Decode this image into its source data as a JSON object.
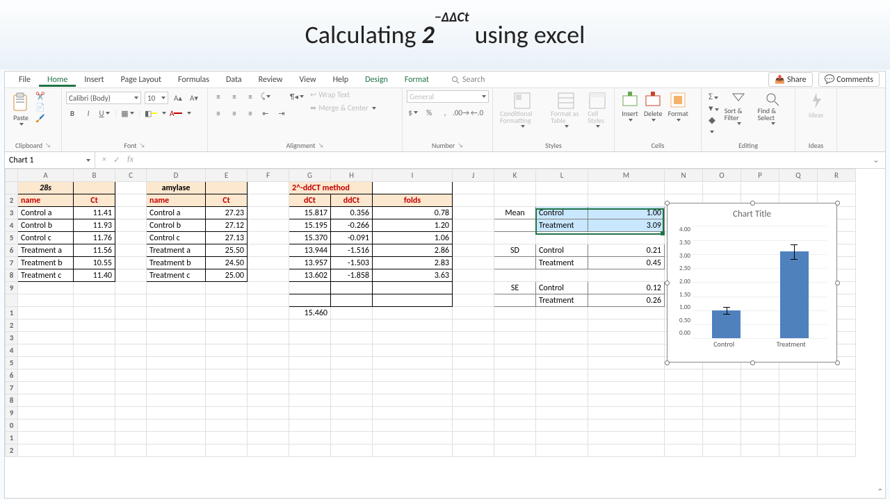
{
  "banner": {
    "pre": "Calculating ",
    "base": "2",
    "exp": "−ΔΔCt",
    "post": " using excel"
  },
  "menubar": {
    "tabs": [
      "File",
      "Home",
      "Insert",
      "Page Layout",
      "Formulas",
      "Data",
      "Review",
      "View",
      "Help",
      "Design",
      "Format"
    ],
    "active_index": 1,
    "chart_tab_start": 9,
    "search_placeholder": "Search",
    "share": "Share",
    "comments": "Comments"
  },
  "ribbon": {
    "clipboard": {
      "paste": "Paste",
      "label": "Clipboard"
    },
    "font": {
      "name": "Calibri (Body)",
      "size": "10",
      "label": "Font"
    },
    "alignment": {
      "wrap": "Wrap Text",
      "merge": "Merge & Center",
      "label": "Alignment"
    },
    "number": {
      "format": "General",
      "label": "Number"
    },
    "styles": {
      "cond": "Conditional Formatting",
      "table": "Format as Table",
      "cell": "Cell Styles",
      "label": "Styles"
    },
    "cells": {
      "insert": "Insert",
      "delete": "Delete",
      "format": "Format",
      "label": "Cells"
    },
    "editing": {
      "sort": "Sort & Filter",
      "find": "Find & Select",
      "label": "Editing"
    },
    "ideas": {
      "label": "Ideas"
    }
  },
  "fbar": {
    "namebox": "Chart 1",
    "fx": "fx"
  },
  "colwidths": {
    "rowhead": 18,
    "A": 80,
    "B": 60,
    "C": 45,
    "D": 85,
    "E": 60,
    "F": 60,
    "G": 60,
    "H": 60,
    "I": 115,
    "J": 60,
    "K": 60,
    "L": 75,
    "M": 110,
    "N": 55,
    "O": 55,
    "P": 55,
    "Q": 55,
    "R": 55
  },
  "col_letters": [
    "A",
    "B",
    "C",
    "D",
    "E",
    "F",
    "G",
    "H",
    "I",
    "J",
    "K",
    "L",
    "M",
    "N",
    "O",
    "P",
    "Q",
    "R"
  ],
  "row_labels": [
    "",
    "2",
    "3",
    "4",
    "5",
    "6",
    "7",
    "8",
    "9",
    "",
    "1",
    "2",
    "3",
    "4",
    "5",
    "6",
    "7",
    "8",
    "9",
    "0",
    "1",
    "2"
  ],
  "sheet": {
    "t28s_header": "28s",
    "amylase_header": "amylase",
    "name_label": "name",
    "ct_label": "Ct",
    "method_header": "2^-ddCT method",
    "dct": "dCt",
    "ddct": "ddCt",
    "folds": "folds",
    "mean": "Mean",
    "sd": "SD",
    "se": "SE",
    "control": "Control",
    "treatment": "Treatment",
    "t28s_rows": [
      [
        "Control a",
        "11.41"
      ],
      [
        "Control b",
        "11.93"
      ],
      [
        "Control c",
        "11.76"
      ],
      [
        "Treatment a",
        "11.56"
      ],
      [
        "Treatment b",
        "10.55"
      ],
      [
        "Treatment c",
        "11.40"
      ]
    ],
    "amy_rows": [
      [
        "Control a",
        "27.23"
      ],
      [
        "Control b",
        "27.12"
      ],
      [
        "Control c",
        "27.13"
      ],
      [
        "Treatment a",
        "25.50"
      ],
      [
        "Treatment b",
        "24.50"
      ],
      [
        "Treatment c",
        "25.00"
      ]
    ],
    "method_rows": [
      [
        "15.817",
        "0.356",
        "0.78"
      ],
      [
        "15.195",
        "-0.266",
        "1.20"
      ],
      [
        "15.370",
        "-0.091",
        "1.06"
      ],
      [
        "13.944",
        "-1.516",
        "2.86"
      ],
      [
        "13.957",
        "-1.503",
        "2.83"
      ],
      [
        "13.602",
        "-1.858",
        "3.63"
      ]
    ],
    "avg_row_g": "15.460",
    "stats": {
      "mean": {
        "control": "1.00",
        "treatment": "3.09"
      },
      "sd": {
        "control": "0.21",
        "treatment": "0.45"
      },
      "se": {
        "control": "0.12",
        "treatment": "0.26"
      }
    }
  },
  "chart": {
    "title": "Chart Title",
    "x_labels": [
      "Control",
      "Treatment"
    ],
    "y_ticks": [
      "4.00",
      "3.50",
      "3.00",
      "2.50",
      "2.00",
      "1.50",
      "1.00",
      "0.50",
      "0.00"
    ]
  },
  "chart_data": {
    "type": "bar",
    "title": "Chart Title",
    "categories": [
      "Control",
      "Treatment"
    ],
    "values": [
      1.0,
      3.09
    ],
    "error_bars": [
      0.12,
      0.26
    ],
    "ylabel": "",
    "xlabel": "",
    "ylim": [
      0,
      4.0
    ],
    "y_step": 0.5,
    "bar_color": "#4f81bd"
  }
}
